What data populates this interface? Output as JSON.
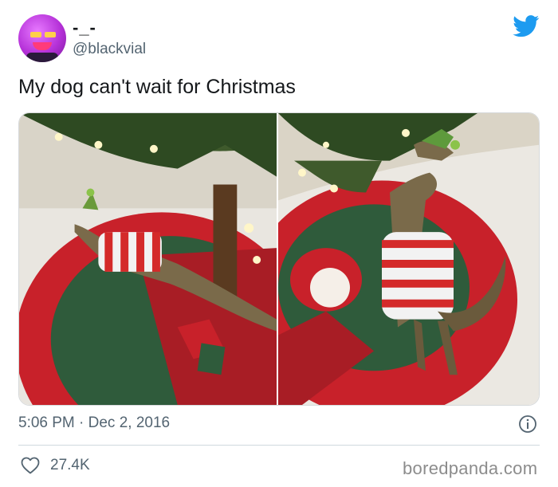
{
  "author": {
    "display_name": "-_-",
    "handle": "@blackvial"
  },
  "tweet": {
    "text": "My dog can't wait for Christmas",
    "timestamp": "5:06 PM · Dec 2, 2016",
    "like_count": "27.4K"
  },
  "icons": {
    "brand": "twitter-bird-icon",
    "info": "info-icon",
    "like": "heart-icon"
  },
  "colors": {
    "brand_blue": "#1d9bf0",
    "secondary_text": "#536471"
  },
  "watermark": "boredpanda.com"
}
